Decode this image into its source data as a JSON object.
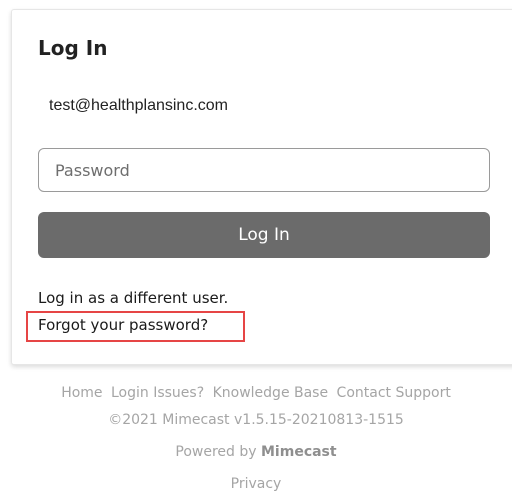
{
  "login": {
    "title": "Log In",
    "email": "test@healthplansinc.com",
    "password_placeholder": "Password",
    "button_label": "Log In",
    "different_user_link": "Log in as a different user.",
    "forgot_password_link": "Forgot your password?"
  },
  "footer": {
    "links": [
      "Home",
      "Login Issues?",
      "Knowledge Base",
      "Contact Support"
    ],
    "copyright": "©2021 Mimecast v1.5.15-20210813-1515",
    "powered_prefix": "Powered by",
    "powered_brand": "Mimecast",
    "privacy": "Privacy"
  },
  "colors": {
    "button_bg": "#6b6b6b",
    "highlight_border": "#e64545",
    "footer_text": "#a5a5a5"
  }
}
